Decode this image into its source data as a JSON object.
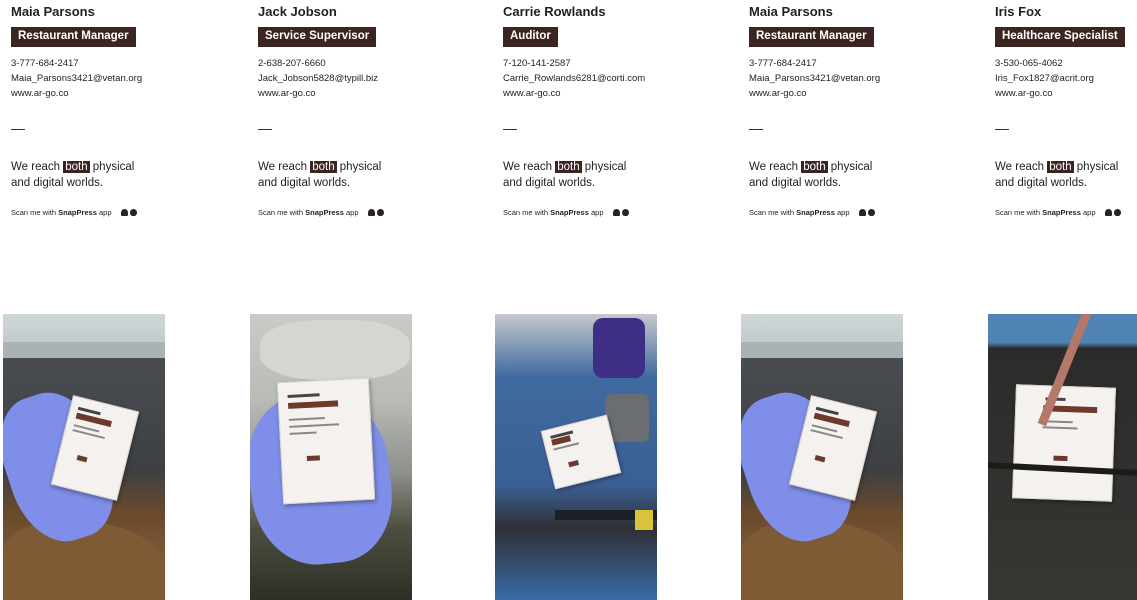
{
  "cards": [
    {
      "name": "Maia Parsons",
      "role": "Restaurant Manager",
      "phone": "3-777-684-2417",
      "email": "Maia_Parsons3421@vetan.org",
      "website": "www.ar-go.co",
      "tagline_before": "We reach ",
      "tagline_highlight": "both",
      "tagline_after": " physical",
      "tagline_line2": "and digital worlds.",
      "scan_prefix": "Scan me with ",
      "scan_app": "SnapPress",
      "scan_suffix": " app",
      "photo_scene": "window"
    },
    {
      "name": "Jack Jobson",
      "role": "Service Supervisor",
      "phone": "2-638-207-6660",
      "email": "Jack_Jobson5828@typill.biz",
      "website": "www.ar-go.co",
      "tagline_before": "We reach ",
      "tagline_highlight": "both",
      "tagline_after": " physical",
      "tagline_line2": "and digital worlds.",
      "scan_prefix": "Scan me with ",
      "scan_app": "SnapPress",
      "scan_suffix": " app",
      "photo_scene": "bed"
    },
    {
      "name": "Carrie Rowlands",
      "role": "Auditor",
      "phone": "7-120-141-2587",
      "email": "Carrie_Rowlands6281@corti.com",
      "website": "www.ar-go.co",
      "tagline_before": "We reach ",
      "tagline_highlight": "both",
      "tagline_after": " physical",
      "tagline_line2": "and digital worlds.",
      "scan_prefix": "Scan me with ",
      "scan_app": "SnapPress",
      "scan_suffix": " app",
      "photo_scene": "desk"
    },
    {
      "name": "Maia Parsons",
      "role": "Restaurant Manager",
      "phone": "3-777-684-2417",
      "email": "Maia_Parsons3421@vetan.org",
      "website": "www.ar-go.co",
      "tagline_before": "We reach ",
      "tagline_highlight": "both",
      "tagline_after": " physical",
      "tagline_line2": "and digital worlds.",
      "scan_prefix": "Scan me with ",
      "scan_app": "SnapPress",
      "scan_suffix": " app",
      "photo_scene": "window"
    },
    {
      "name": "Iris Fox",
      "role": "Healthcare Specialist",
      "phone": "3-530-065-4062",
      "email": "Iris_Fox1827@acrit.org",
      "website": "www.ar-go.co",
      "tagline_before": "We reach ",
      "tagline_highlight": "both",
      "tagline_after": " physical",
      "tagline_line2": "and digital worlds.",
      "scan_prefix": "Scan me with ",
      "scan_app": "SnapPress",
      "scan_suffix": " app",
      "photo_scene": "pen"
    }
  ],
  "colors": {
    "badge_bg": "#3b2520",
    "badge_text": "#ffffff",
    "text": "#222222"
  },
  "icons": [
    "android-icon",
    "apple-icon"
  ]
}
